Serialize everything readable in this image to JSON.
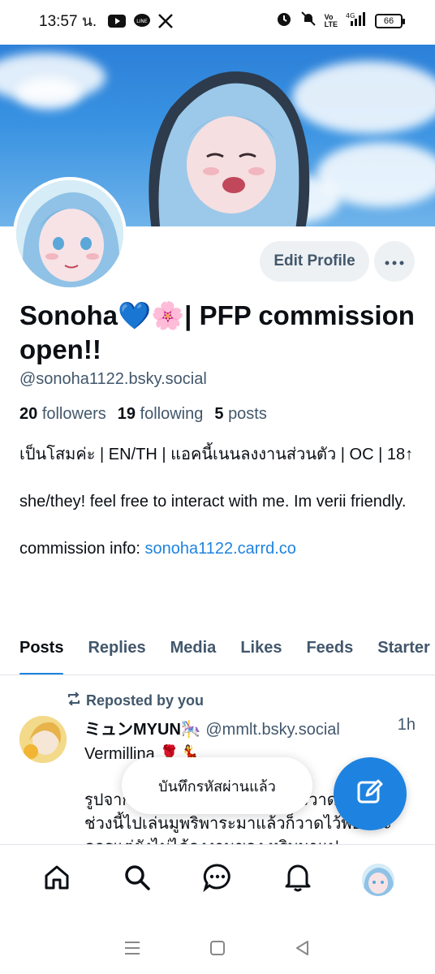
{
  "status_bar": {
    "time": "13:57 น.",
    "battery": "66",
    "network": "4G"
  },
  "profile": {
    "display_name": "Sonoha💙🌸| PFP commission open!!",
    "handle": "@sonoha1122.bsky.social",
    "edit_label": "Edit Profile",
    "stats": {
      "followers_count": "20",
      "followers_label": "followers",
      "following_count": "19",
      "following_label": "following",
      "posts_count": "5",
      "posts_label": "posts"
    },
    "bio": {
      "line1": "เป็นโสมค่ะ  | EN/TH | แอคนี้เนนลงงานส่วนตัว | OC | 18↑",
      "line2": " she/they! feel free to interact with me. Im verii friendly.",
      "line3_prefix": "commission info: ",
      "line3_link": "sonoha1122.carrd.co"
    }
  },
  "tabs": [
    "Posts",
    "Replies",
    "Media",
    "Likes",
    "Feeds",
    "Starter Packs"
  ],
  "post": {
    "repost_label": "Reposted by you",
    "author": "ミュンMYUN🎠",
    "author_handle": "@mmlt.bsky.social",
    "time": "1h",
    "line1": "Vermillina 🌹💃",
    "body": "รูปจากคอมมิชชั่นค่ะ ภาพนี้ตั้งใจวาดมาก.ค่ะ ช่วงนี้ไปเล่นมูพริพาระมาแล้วก็วาดไว้พอดีค่ะ ควรแต่ยังไม่ได้ลงงานของ หริบมาแปะ"
  },
  "toast": "บันทึกรหัสผ่านแล้ว",
  "colors": {
    "accent": "#1e83e0",
    "muted": "#42576c",
    "button_bg": "#eef1f4"
  }
}
